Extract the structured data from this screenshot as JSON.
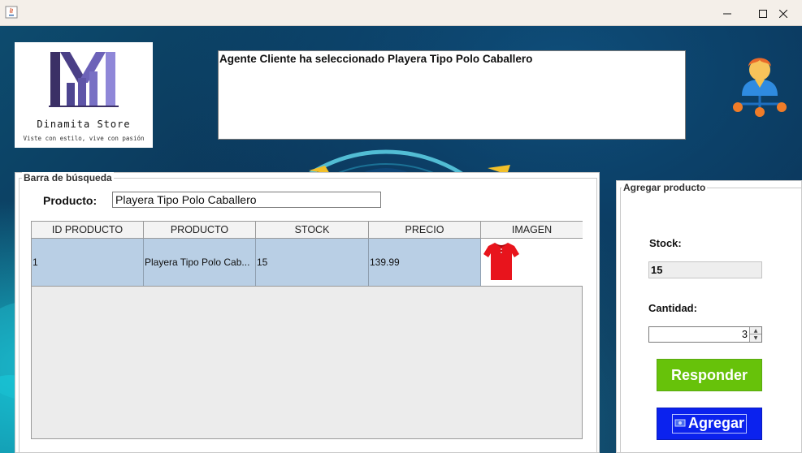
{
  "window": {
    "minimize_icon": "minimize-icon",
    "maximize_icon": "maximize-icon",
    "close_icon": "close-icon"
  },
  "logo": {
    "name": "Dinamita Store",
    "tagline": "Viste con estilo, vive con pasión"
  },
  "message": "Agente Cliente ha seleccionado Playera Tipo Polo Caballero",
  "search": {
    "legend": "Barra de búsqueda",
    "product_label": "Producto:",
    "product_value": "Playera Tipo Polo Caballero"
  },
  "table": {
    "columns": [
      "ID PRODUCTO",
      "PRODUCTO",
      "STOCK",
      "PRECIO",
      "IMAGEN"
    ],
    "rows": [
      {
        "id": "1",
        "product": "Playera Tipo Polo Cab...",
        "stock": "15",
        "price": "139.99",
        "image": "red-polo-shirt"
      }
    ]
  },
  "add_product": {
    "legend": "Agregar producto",
    "stock_label": "Stock:",
    "stock_value": "15",
    "quantity_label": "Cantidad:",
    "quantity_value": "3",
    "respond_button": "Responder",
    "add_button": "Agregar"
  },
  "colors": {
    "respond_button": "#67c20a",
    "add_button": "#0b22ee",
    "selected_row": "#b9cfe5"
  }
}
